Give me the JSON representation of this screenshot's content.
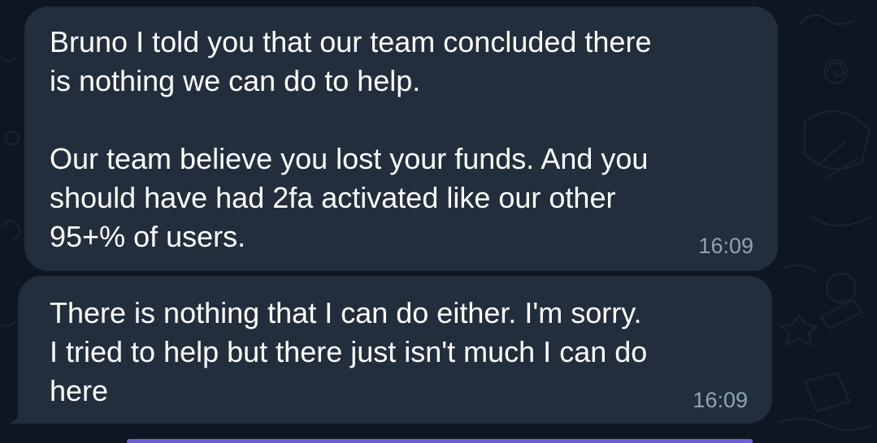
{
  "chat": {
    "messages": [
      {
        "lines": [
          "Bruno I told you that our team concluded there",
          "is nothing we can do to help.",
          "Our team believe you lost your funds. And you",
          "should have had 2fa activated like our other",
          "95+% of users."
        ],
        "time": "16:09"
      },
      {
        "lines": [
          "There is nothing that I can do either. I'm sorry.",
          "I tried to help but there just isn't much I can do",
          "here"
        ],
        "time": "16:09"
      }
    ]
  },
  "colors": {
    "background": "#0e1621",
    "bubble": "#232e3c",
    "text": "#ffffff",
    "timestamp": "#8fa3b6",
    "accent_bar": "#6d5ed8"
  }
}
